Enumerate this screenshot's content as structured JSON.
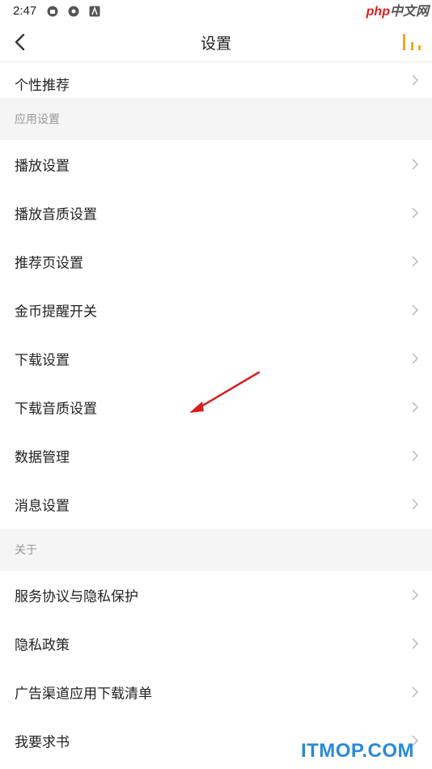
{
  "status_bar": {
    "time": "2:47"
  },
  "nav": {
    "title": "设置"
  },
  "rows_top": [
    {
      "label": "个性推荐"
    }
  ],
  "sections": [
    {
      "title": "应用设置",
      "items": [
        {
          "label": "播放设置"
        },
        {
          "label": "播放音质设置"
        },
        {
          "label": "推荐页设置"
        },
        {
          "label": "金币提醒开关"
        },
        {
          "label": "下载设置"
        },
        {
          "label": "下载音质设置"
        },
        {
          "label": "数据管理"
        },
        {
          "label": "消息设置"
        }
      ]
    },
    {
      "title": "关于",
      "items": [
        {
          "label": "服务协议与隐私保护"
        },
        {
          "label": "隐私政策"
        },
        {
          "label": "广告渠道应用下载清单"
        },
        {
          "label": "我要求书"
        }
      ]
    }
  ],
  "watermarks": {
    "php_a": "php",
    "php_b": "中文网",
    "itmop": "ITMOP.COM"
  },
  "colors": {
    "accent": "#f5a623",
    "annotation_arrow": "#d42020",
    "section_bg": "#f5f5f5",
    "chevron": "#bbbbbb"
  },
  "icons": [
    "back-arrow-icon",
    "bar-chart-icon",
    "chevron-right-icon"
  ]
}
